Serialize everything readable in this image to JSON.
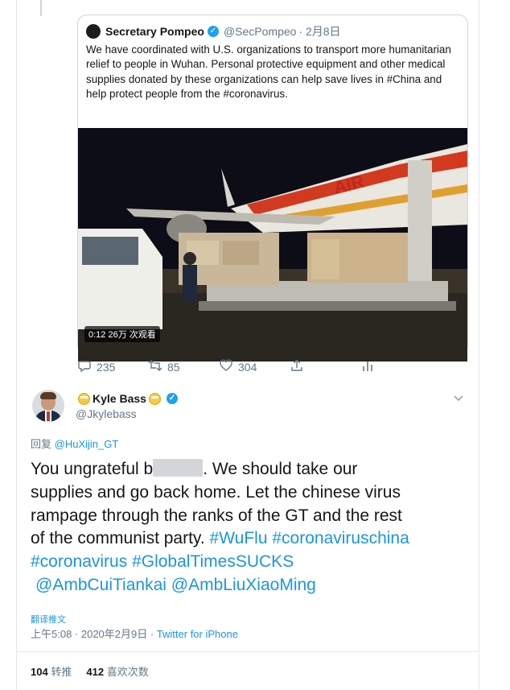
{
  "quoted_tweet": {
    "name": "Secretary Pompeo",
    "handle": "@SecPompeo",
    "date": "· 2月8日",
    "text": "We have coordinated with U.S. organizations to transport more humanitarian relief to people in Wuhan. Personal protective equipment and other medical supplies donated by these organizations can help save lives in #China and help protect people from the #coronavirus.",
    "video_badge": "0:12  26万 次观看"
  },
  "actions": {
    "replies": "235",
    "retweets": "85",
    "likes": "304"
  },
  "reply_tweet": {
    "name": "Kyle Bass",
    "handle": "@Jkylebass",
    "replying_prefix": "回复 ",
    "replying_to": "@HuXijin_GT",
    "line1_a": "You ungrateful b",
    "line1_b": ". We should take our",
    "line2": "supplies and go back home. Let the chinese virus",
    "line3": "rampage through the ranks of the GT and the rest",
    "line4_a": "of the communist party. ",
    "hashtag_wuflu": "#WuFlu",
    "hashtag_cvchina": "#coronaviruschina",
    "hashtag_coronavirus": "#coronavirus",
    "hashtag_gtsucks": "#GlobalTimesSUCKS",
    "mention_cui": "@AmbCuiTiankai",
    "mention_liu": "@AmbLiuXiaoMing",
    "translate": "翻译推文",
    "timestamp": "上午5:08 · 2020年2月9日 · ",
    "source": "Twitter for iPhone"
  },
  "stats": {
    "retweets_count": "104",
    "retweets_label": "转推",
    "likes_count": "412",
    "likes_label": "喜欢次数"
  },
  "icons": [
    "verified-icon",
    "reply-icon",
    "retweet-icon",
    "like-icon",
    "share-icon",
    "analytics-icon",
    "chevron-down-icon"
  ],
  "colors": {
    "link": "#1b95e0",
    "muted": "#657786",
    "verified": "#1da1f2"
  }
}
